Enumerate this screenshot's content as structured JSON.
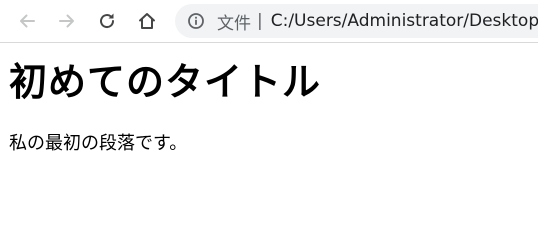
{
  "browser": {
    "address_bar": {
      "scheme_label": "文件",
      "separator": "|",
      "url": "C:/Users/Administrator/Desktop"
    },
    "icons": {
      "back": "back-arrow-icon",
      "forward": "forward-arrow-icon",
      "reload": "reload-icon",
      "home": "home-icon",
      "site_info": "info-icon"
    },
    "colors": {
      "icon_disabled": "#c4c7c5",
      "icon_active": "#444746",
      "omnibox_bg": "#f1f3f4"
    }
  },
  "page": {
    "heading": "初めてのタイトル",
    "paragraph": "私の最初の段落です。"
  }
}
